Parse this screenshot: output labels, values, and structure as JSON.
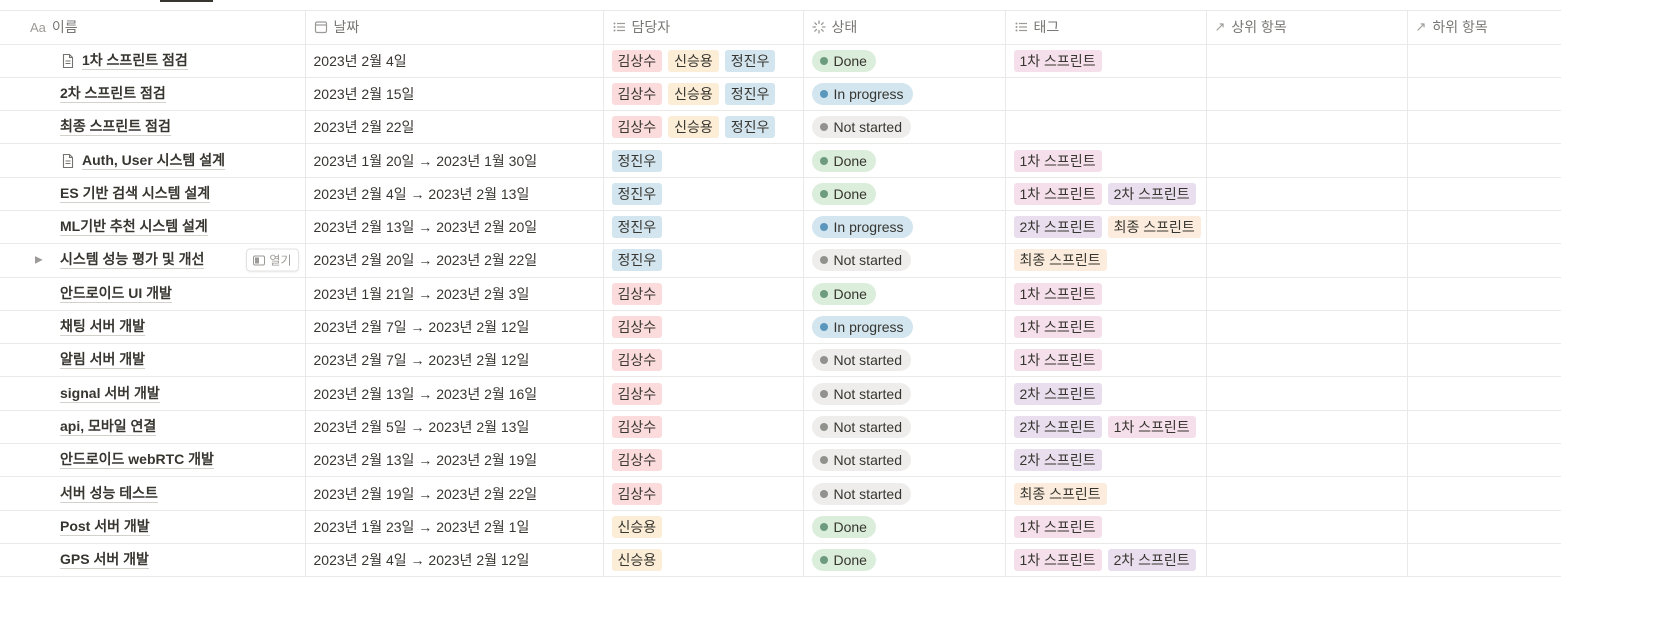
{
  "headers": {
    "name": {
      "icon": "Aa",
      "label": "이름"
    },
    "date": {
      "label": "날짜"
    },
    "assignee": {
      "label": "담당자"
    },
    "status": {
      "label": "상태"
    },
    "tags": {
      "label": "태그"
    },
    "parent": {
      "icon": "↗",
      "label": "상위 항목"
    },
    "child": {
      "icon": "↗",
      "label": "하위 항목"
    }
  },
  "open_button_label": "열기",
  "colors": {
    "person": {
      "김상수": "#fbdbdb",
      "신승용": "#fbedd6",
      "정진우": "#d3e5ef"
    },
    "status": {
      "Done": {
        "bg": "#dbeddb",
        "dot": "#6c9b7d"
      },
      "In progress": {
        "bg": "#d3e5ef",
        "dot": "#5b97bd"
      },
      "Not started": {
        "bg": "#eeedeb",
        "dot": "#91918e"
      }
    },
    "tag": {
      "1차 스프린트": "#f4dfeb",
      "2차 스프린트": "#e8deee",
      "최종 스프린트": "#fbecdd"
    }
  },
  "rows": [
    {
      "name": "1차 스프린트 점검",
      "doc_icon": true,
      "date": "2023년 2월 4일",
      "assignees": [
        "김상수",
        "신승용",
        "정진우"
      ],
      "status": "Done",
      "tags": [
        "1차 스프린트"
      ]
    },
    {
      "name": "2차 스프린트 점검",
      "date": "2023년 2월 15일",
      "assignees": [
        "김상수",
        "신승용",
        "정진우"
      ],
      "status": "In progress",
      "tags": []
    },
    {
      "name": "최종 스프린트 점검",
      "date": "2023년 2월 22일",
      "assignees": [
        "김상수",
        "신승용",
        "정진우"
      ],
      "status": "Not started",
      "tags": []
    },
    {
      "name": "Auth, User 시스템 설계",
      "doc_icon": true,
      "date": "2023년 1월 20일 → 2023년 1월 30일",
      "assignees": [
        "정진우"
      ],
      "status": "Done",
      "tags": [
        "1차 스프린트"
      ]
    },
    {
      "name": "ES 기반 검색 시스템 설계",
      "date": "2023년 2월 4일 → 2023년 2월 13일",
      "assignees": [
        "정진우"
      ],
      "status": "Done",
      "tags": [
        "1차 스프린트",
        "2차 스프린트"
      ]
    },
    {
      "name": "ML기반 추천 시스템 설계",
      "date": "2023년 2월 13일 → 2023년 2월 20일",
      "assignees": [
        "정진우"
      ],
      "status": "In progress",
      "tags": [
        "2차 스프린트",
        "최종 스프린트"
      ]
    },
    {
      "name": "시스템 성능 평가 및 개선",
      "expandable": true,
      "hovered": true,
      "date": "2023년 2월 20일 → 2023년 2월 22일",
      "assignees": [
        "정진우"
      ],
      "status": "Not started",
      "tags": [
        "최종 스프린트"
      ]
    },
    {
      "name": "안드로이드 UI 개발",
      "date": "2023년 1월 21일 → 2023년 2월 3일",
      "assignees": [
        "김상수"
      ],
      "status": "Done",
      "tags": [
        "1차 스프린트"
      ]
    },
    {
      "name": "채팅 서버 개발",
      "date": "2023년 2월 7일 → 2023년 2월 12일",
      "assignees": [
        "김상수"
      ],
      "status": "In progress",
      "tags": [
        "1차 스프린트"
      ]
    },
    {
      "name": "알림 서버 개발",
      "date": "2023년 2월 7일 → 2023년 2월 12일",
      "assignees": [
        "김상수"
      ],
      "status": "Not started",
      "tags": [
        "1차 스프린트"
      ]
    },
    {
      "name": "signal 서버 개발",
      "date": "2023년 2월 13일 → 2023년 2월 16일",
      "assignees": [
        "김상수"
      ],
      "status": "Not started",
      "tags": [
        "2차 스프린트"
      ]
    },
    {
      "name": "api, 모바일 연결",
      "date": "2023년 2월 5일 → 2023년 2월 13일",
      "assignees": [
        "김상수"
      ],
      "status": "Not started",
      "tags": [
        "2차 스프린트",
        "1차 스프린트"
      ]
    },
    {
      "name": "안드로이드 webRTC 개발",
      "date": "2023년 2월 13일 → 2023년 2월 19일",
      "assignees": [
        "김상수"
      ],
      "status": "Not started",
      "tags": [
        "2차 스프린트"
      ]
    },
    {
      "name": "서버 성능 테스트",
      "date": "2023년 2월 19일 → 2023년 2월 22일",
      "assignees": [
        "김상수"
      ],
      "status": "Not started",
      "tags": [
        "최종 스프린트"
      ]
    },
    {
      "name": "Post 서버 개발",
      "date": "2023년 1월 23일 → 2023년 2월 1일",
      "assignees": [
        "신승용"
      ],
      "status": "Done",
      "tags": [
        "1차 스프린트"
      ]
    },
    {
      "name": "GPS 서버 개발",
      "date": "2023년 2월 4일 → 2023년 2월 12일",
      "assignees": [
        "신승용"
      ],
      "status": "Done",
      "tags": [
        "1차 스프린트",
        "2차 스프린트"
      ]
    }
  ]
}
